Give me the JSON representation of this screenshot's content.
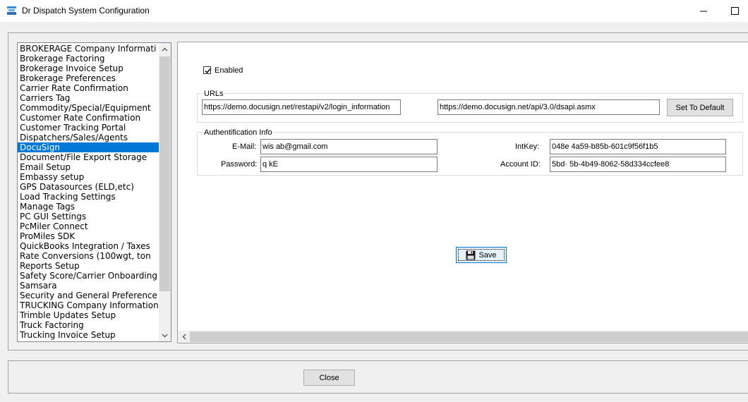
{
  "window": {
    "title": "Dr Dispatch  System Configuration",
    "minimize_glyph": "—",
    "maximize_glyph": "☐"
  },
  "sidebar": {
    "items": [
      {
        "label": "BROKERAGE Company Informati"
      },
      {
        "label": "Brokerage Factoring"
      },
      {
        "label": "Brokerage Invoice Setup"
      },
      {
        "label": "Brokerage Preferences"
      },
      {
        "label": "Carrier Rate Confirmation"
      },
      {
        "label": "Carriers Tag"
      },
      {
        "label": "Commodity/Special/Equipment"
      },
      {
        "label": "Customer Rate Confirmation"
      },
      {
        "label": "Customer Tracking Portal"
      },
      {
        "label": "Dispatchers/Sales/Agents"
      },
      {
        "label": "DocuSign"
      },
      {
        "label": "Document/File Export Storage"
      },
      {
        "label": "Email Setup"
      },
      {
        "label": "Embassy setup"
      },
      {
        "label": "GPS Datasources (ELD,etc)"
      },
      {
        "label": "Load Tracking Settings"
      },
      {
        "label": "Manage Tags"
      },
      {
        "label": "PC GUI Settings"
      },
      {
        "label": "PcMiler Connect"
      },
      {
        "label": "ProMiles SDK"
      },
      {
        "label": "QuickBooks Integration / Taxes"
      },
      {
        "label": "Rate Conversions (100wgt, ton"
      },
      {
        "label": "Reports Setup"
      },
      {
        "label": "Safety Score/Carrier Onboarding"
      },
      {
        "label": "Samsara"
      },
      {
        "label": "Security and General Preference"
      },
      {
        "label": "TRUCKING Company Information"
      },
      {
        "label": "Trimble Updates Setup"
      },
      {
        "label": "Truck Factoring"
      },
      {
        "label": "Trucking Invoice Setup"
      }
    ],
    "selected_index": 10,
    "selected_label": "DocuSign"
  },
  "docusign": {
    "enabled_label": "Enabled",
    "enabled": true,
    "urls": {
      "group_label": "URLs",
      "login_url": "https://demo.docusign.net/restapi/v2/login_information",
      "api_url": "https://demo.docusign.net/api/3.0/dsapi.asmx",
      "set_default_label": "Set To Default"
    },
    "auth": {
      "group_label": "Authentification Info",
      "email_label": "E-Mail:",
      "email_value": "wis        ab@gmail.com",
      "password_label": "Password:",
      "password_value": "q    kE",
      "intkey_label": "IntKey:",
      "intkey_value": "048e                    4a59-b85b-601c9f56f1b5",
      "account_label": "Account ID:",
      "account_value": "5bd·                 5b-4b49-8062-58d334ccfee8"
    },
    "save_label": "Save"
  },
  "footer": {
    "close_label": "Close"
  },
  "colors": {
    "selection": "#0078d7",
    "background": "#f0f0f0"
  }
}
